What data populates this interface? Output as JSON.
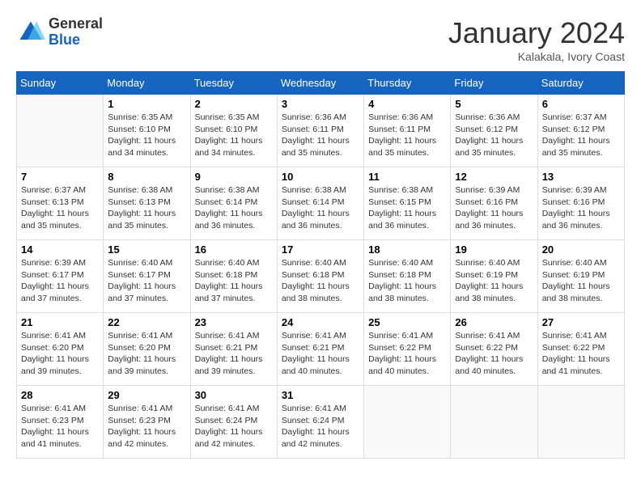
{
  "logo": {
    "general": "General",
    "blue": "Blue"
  },
  "title": "January 2024",
  "location": "Kalakala, Ivory Coast",
  "days_header": [
    "Sunday",
    "Monday",
    "Tuesday",
    "Wednesday",
    "Thursday",
    "Friday",
    "Saturday"
  ],
  "weeks": [
    [
      {
        "day": "",
        "info": ""
      },
      {
        "day": "1",
        "info": "Sunrise: 6:35 AM\nSunset: 6:10 PM\nDaylight: 11 hours\nand 34 minutes."
      },
      {
        "day": "2",
        "info": "Sunrise: 6:35 AM\nSunset: 6:10 PM\nDaylight: 11 hours\nand 34 minutes."
      },
      {
        "day": "3",
        "info": "Sunrise: 6:36 AM\nSunset: 6:11 PM\nDaylight: 11 hours\nand 35 minutes."
      },
      {
        "day": "4",
        "info": "Sunrise: 6:36 AM\nSunset: 6:11 PM\nDaylight: 11 hours\nand 35 minutes."
      },
      {
        "day": "5",
        "info": "Sunrise: 6:36 AM\nSunset: 6:12 PM\nDaylight: 11 hours\nand 35 minutes."
      },
      {
        "day": "6",
        "info": "Sunrise: 6:37 AM\nSunset: 6:12 PM\nDaylight: 11 hours\nand 35 minutes."
      }
    ],
    [
      {
        "day": "7",
        "info": "Sunrise: 6:37 AM\nSunset: 6:13 PM\nDaylight: 11 hours\nand 35 minutes."
      },
      {
        "day": "8",
        "info": "Sunrise: 6:38 AM\nSunset: 6:13 PM\nDaylight: 11 hours\nand 35 minutes."
      },
      {
        "day": "9",
        "info": "Sunrise: 6:38 AM\nSunset: 6:14 PM\nDaylight: 11 hours\nand 36 minutes."
      },
      {
        "day": "10",
        "info": "Sunrise: 6:38 AM\nSunset: 6:14 PM\nDaylight: 11 hours\nand 36 minutes."
      },
      {
        "day": "11",
        "info": "Sunrise: 6:38 AM\nSunset: 6:15 PM\nDaylight: 11 hours\nand 36 minutes."
      },
      {
        "day": "12",
        "info": "Sunrise: 6:39 AM\nSunset: 6:16 PM\nDaylight: 11 hours\nand 36 minutes."
      },
      {
        "day": "13",
        "info": "Sunrise: 6:39 AM\nSunset: 6:16 PM\nDaylight: 11 hours\nand 36 minutes."
      }
    ],
    [
      {
        "day": "14",
        "info": "Sunrise: 6:39 AM\nSunset: 6:17 PM\nDaylight: 11 hours\nand 37 minutes."
      },
      {
        "day": "15",
        "info": "Sunrise: 6:40 AM\nSunset: 6:17 PM\nDaylight: 11 hours\nand 37 minutes."
      },
      {
        "day": "16",
        "info": "Sunrise: 6:40 AM\nSunset: 6:18 PM\nDaylight: 11 hours\nand 37 minutes."
      },
      {
        "day": "17",
        "info": "Sunrise: 6:40 AM\nSunset: 6:18 PM\nDaylight: 11 hours\nand 38 minutes."
      },
      {
        "day": "18",
        "info": "Sunrise: 6:40 AM\nSunset: 6:18 PM\nDaylight: 11 hours\nand 38 minutes."
      },
      {
        "day": "19",
        "info": "Sunrise: 6:40 AM\nSunset: 6:19 PM\nDaylight: 11 hours\nand 38 minutes."
      },
      {
        "day": "20",
        "info": "Sunrise: 6:40 AM\nSunset: 6:19 PM\nDaylight: 11 hours\nand 38 minutes."
      }
    ],
    [
      {
        "day": "21",
        "info": "Sunrise: 6:41 AM\nSunset: 6:20 PM\nDaylight: 11 hours\nand 39 minutes."
      },
      {
        "day": "22",
        "info": "Sunrise: 6:41 AM\nSunset: 6:20 PM\nDaylight: 11 hours\nand 39 minutes."
      },
      {
        "day": "23",
        "info": "Sunrise: 6:41 AM\nSunset: 6:21 PM\nDaylight: 11 hours\nand 39 minutes."
      },
      {
        "day": "24",
        "info": "Sunrise: 6:41 AM\nSunset: 6:21 PM\nDaylight: 11 hours\nand 40 minutes."
      },
      {
        "day": "25",
        "info": "Sunrise: 6:41 AM\nSunset: 6:22 PM\nDaylight: 11 hours\nand 40 minutes."
      },
      {
        "day": "26",
        "info": "Sunrise: 6:41 AM\nSunset: 6:22 PM\nDaylight: 11 hours\nand 40 minutes."
      },
      {
        "day": "27",
        "info": "Sunrise: 6:41 AM\nSunset: 6:22 PM\nDaylight: 11 hours\nand 41 minutes."
      }
    ],
    [
      {
        "day": "28",
        "info": "Sunrise: 6:41 AM\nSunset: 6:23 PM\nDaylight: 11 hours\nand 41 minutes."
      },
      {
        "day": "29",
        "info": "Sunrise: 6:41 AM\nSunset: 6:23 PM\nDaylight: 11 hours\nand 42 minutes."
      },
      {
        "day": "30",
        "info": "Sunrise: 6:41 AM\nSunset: 6:24 PM\nDaylight: 11 hours\nand 42 minutes."
      },
      {
        "day": "31",
        "info": "Sunrise: 6:41 AM\nSunset: 6:24 PM\nDaylight: 11 hours\nand 42 minutes."
      },
      {
        "day": "",
        "info": ""
      },
      {
        "day": "",
        "info": ""
      },
      {
        "day": "",
        "info": ""
      }
    ]
  ]
}
